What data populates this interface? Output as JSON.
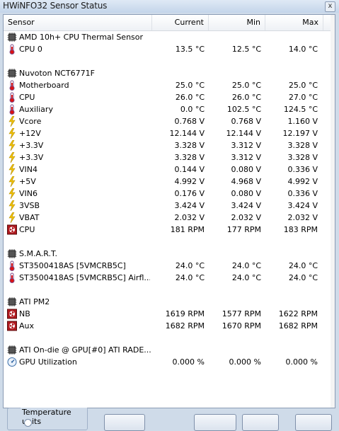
{
  "window": {
    "title": "HWiNFO32 Sensor Status",
    "close_glyph": "x"
  },
  "columns": {
    "sensor": "Sensor",
    "current": "Current",
    "min": "Min",
    "max": "Max"
  },
  "rows": [
    {
      "kind": "group",
      "name": "AMD 10h+ CPU Thermal Sensor"
    },
    {
      "kind": "sensor",
      "icon": "thermometer",
      "name": "CPU 0",
      "current": "13.5 °C",
      "min": "12.5 °C",
      "max": "14.0 °C"
    },
    {
      "kind": "blank"
    },
    {
      "kind": "group",
      "name": "Nuvoton NCT6771F"
    },
    {
      "kind": "sensor",
      "icon": "thermometer",
      "name": "Motherboard",
      "current": "25.0 °C",
      "min": "25.0 °C",
      "max": "25.0 °C"
    },
    {
      "kind": "sensor",
      "icon": "thermometer",
      "name": "CPU",
      "current": "26.0 °C",
      "min": "26.0 °C",
      "max": "27.0 °C"
    },
    {
      "kind": "sensor",
      "icon": "thermometer",
      "name": "Auxiliary",
      "current": "0.0 °C",
      "min": "102.5 °C",
      "max": "124.5 °C"
    },
    {
      "kind": "sensor",
      "icon": "lightning",
      "name": "Vcore",
      "current": "0.768 V",
      "min": "0.768 V",
      "max": "1.160 V"
    },
    {
      "kind": "sensor",
      "icon": "lightning",
      "name": "+12V",
      "current": "12.144 V",
      "min": "12.144 V",
      "max": "12.197 V"
    },
    {
      "kind": "sensor",
      "icon": "lightning",
      "name": "+3.3V",
      "current": "3.328 V",
      "min": "3.312 V",
      "max": "3.328 V"
    },
    {
      "kind": "sensor",
      "icon": "lightning",
      "name": "+3.3V",
      "current": "3.328 V",
      "min": "3.312 V",
      "max": "3.328 V"
    },
    {
      "kind": "sensor",
      "icon": "lightning",
      "name": "VIN4",
      "current": "0.144 V",
      "min": "0.080 V",
      "max": "0.336 V"
    },
    {
      "kind": "sensor",
      "icon": "lightning",
      "name": "+5V",
      "current": "4.992 V",
      "min": "4.968 V",
      "max": "4.992 V"
    },
    {
      "kind": "sensor",
      "icon": "lightning",
      "name": "VIN6",
      "current": "0.176 V",
      "min": "0.080 V",
      "max": "0.336 V"
    },
    {
      "kind": "sensor",
      "icon": "lightning",
      "name": "3VSB",
      "current": "3.424 V",
      "min": "3.424 V",
      "max": "3.424 V"
    },
    {
      "kind": "sensor",
      "icon": "lightning",
      "name": "VBAT",
      "current": "2.032 V",
      "min": "2.032 V",
      "max": "2.032 V"
    },
    {
      "kind": "sensor",
      "icon": "fan",
      "name": "CPU",
      "current": "181 RPM",
      "min": "177 RPM",
      "max": "183 RPM"
    },
    {
      "kind": "blank"
    },
    {
      "kind": "group",
      "name": "S.M.A.R.T."
    },
    {
      "kind": "sensor",
      "icon": "thermometer",
      "name": "ST3500418AS [5VMCRB5C]",
      "current": "24.0 °C",
      "min": "24.0 °C",
      "max": "24.0 °C"
    },
    {
      "kind": "sensor",
      "icon": "thermometer",
      "name": "ST3500418AS [5VMCRB5C] Airfl...",
      "current": "24.0 °C",
      "min": "24.0 °C",
      "max": "24.0 °C"
    },
    {
      "kind": "blank"
    },
    {
      "kind": "group",
      "name": "ATI PM2"
    },
    {
      "kind": "sensor",
      "icon": "fan",
      "name": "NB",
      "current": "1619 RPM",
      "min": "1577 RPM",
      "max": "1622 RPM"
    },
    {
      "kind": "sensor",
      "icon": "fan",
      "name": "Aux",
      "current": "1682 RPM",
      "min": "1670 RPM",
      "max": "1682 RPM"
    },
    {
      "kind": "blank"
    },
    {
      "kind": "group",
      "name": "ATI On-die @ GPU[#0] ATI RADE..."
    },
    {
      "kind": "sensor",
      "icon": "gauge",
      "name": "GPU Utilization",
      "current": "0.000 %",
      "min": "0.000 %",
      "max": "0.000 %"
    }
  ],
  "bottom": {
    "temperature_units_label": "Temperature units"
  },
  "colors": {
    "background": "#cfdbe9",
    "lightning": "#f2c200",
    "thermometer_red": "#d11",
    "fan_red": "#b0191e"
  }
}
